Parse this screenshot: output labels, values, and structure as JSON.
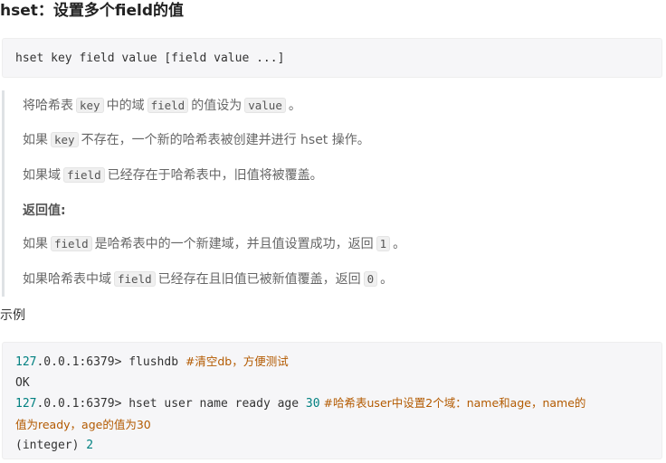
{
  "heading": "hset：设置多个field的值",
  "syntax": "hset key field value [field value ...]",
  "description": {
    "line1": {
      "pre": "将哈希表",
      "c1": "key",
      "mid": "中的域",
      "c2": "field",
      "mid2": "的值设为",
      "c3": "value",
      "post": "。"
    },
    "line2": {
      "pre": "如果",
      "c1": "key",
      "post": "不存在，一个新的哈希表被创建并进行 hset 操作。"
    },
    "line3": {
      "pre": "如果域",
      "c1": "field",
      "post": "已经存在于哈希表中，旧值将被覆盖。"
    },
    "return_heading": "返回值:",
    "line5": {
      "pre": "如果",
      "c1": "field",
      "mid": "是哈希表中的一个新建域，并且值设置成功，返回",
      "c2": "1",
      "post": "。"
    },
    "line6": {
      "pre": "如果哈希表中域",
      "c1": "field",
      "mid": "已经存在且旧值已被新值覆盖，返回",
      "c2": "0",
      "post": "。"
    }
  },
  "example_label": "示例",
  "code": {
    "l1_num": "127",
    "l1_rest": ".0.0.1:6379> flushdb ",
    "l1_comment": "#清空db，方便测试",
    "l2": "OK",
    "l3_num": "127",
    "l3_rest": ".0.0.1:6379> hset user name ready age ",
    "l3_num2": "30",
    "l3_comment": " #哈希表user中设置2个域：name和age，name的",
    "l4_comment": "值为ready，age的值为30",
    "l5_pre": "(integer) ",
    "l5_num": "2"
  }
}
